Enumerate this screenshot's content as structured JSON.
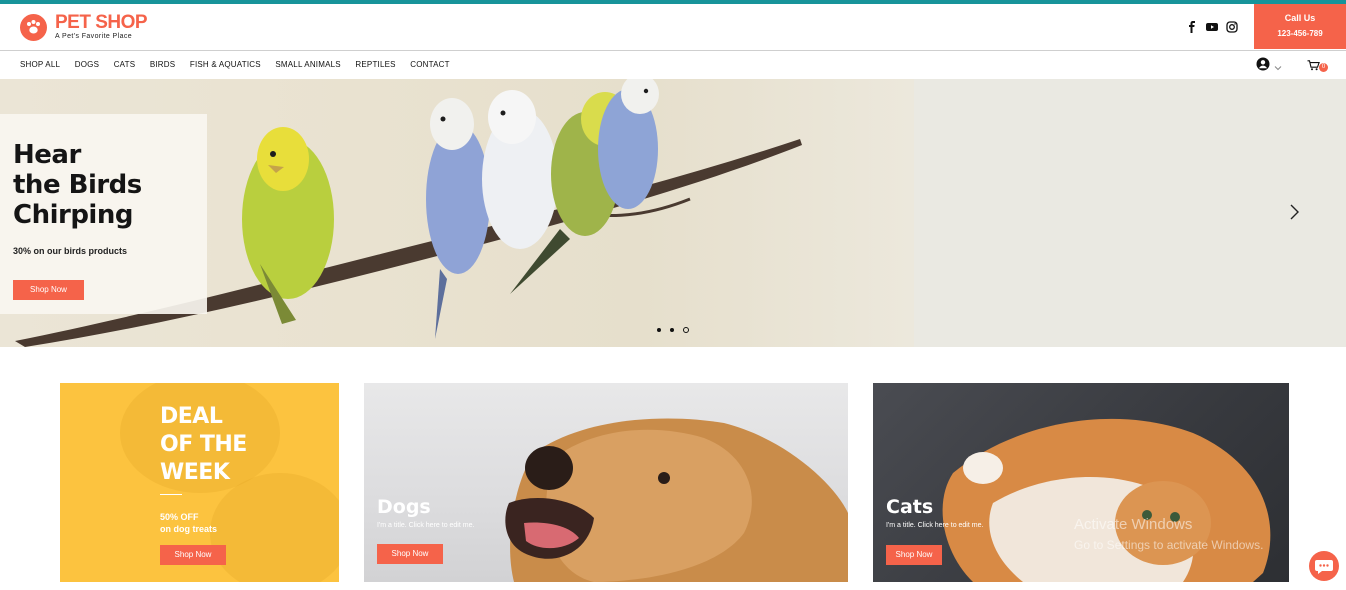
{
  "brand": {
    "name": "PET SHOP",
    "tagline": "A Pet's Favorite Place",
    "accent": "#f5634a",
    "topline": "#17949a"
  },
  "header": {
    "social": [
      "facebook-icon",
      "youtube-icon",
      "instagram-icon"
    ],
    "call_label": "Call Us",
    "call_number": "123-456-789"
  },
  "nav": {
    "items": [
      "SHOP ALL",
      "DOGS",
      "CATS",
      "BIRDS",
      "FISH & AQUATICS",
      "SMALL ANIMALS",
      "REPTILES",
      "CONTACT"
    ],
    "cart_count": "0"
  },
  "hero": {
    "title": "Hear\nthe Birds\nChirping",
    "subtitle": "30% on our birds products",
    "button": "Shop Now",
    "slides": 3,
    "active_slide": 3
  },
  "cards": {
    "deal": {
      "title": "DEAL\nOF THE\nWEEK",
      "subtitle": "50% OFF\non dog treats",
      "button": "Shop Now"
    },
    "dogs": {
      "title": "Dogs",
      "subtitle": "I'm a title. Click here to edit me.",
      "button": "Shop Now"
    },
    "cats": {
      "title": "Cats",
      "subtitle": "I'm a title. Click here to edit me.",
      "button": "Shop Now"
    }
  },
  "watermark": {
    "line1": "Activate Windows",
    "line2": "Go to Settings to activate Windows."
  }
}
